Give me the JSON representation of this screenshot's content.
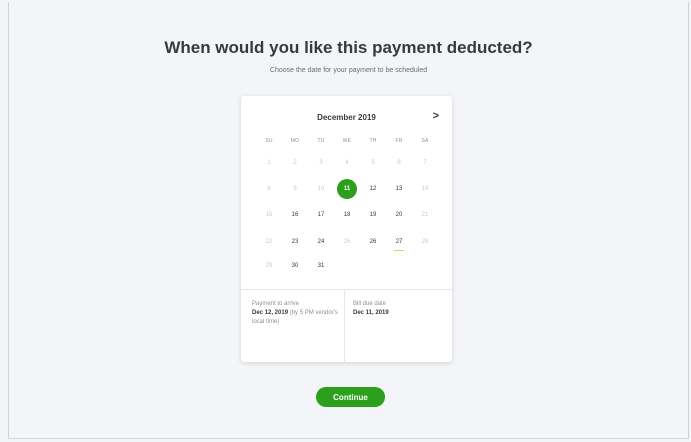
{
  "header": {
    "title": "When would you like this payment deducted?",
    "subtitle": "Choose the date for your payment to be scheduled"
  },
  "calendar": {
    "month_label": "December 2019",
    "next_icon": "chevron-right-icon",
    "next_glyph": ">",
    "weekdays": [
      "SU",
      "MO",
      "TU",
      "WE",
      "TH",
      "FR",
      "SA"
    ],
    "weeks": [
      [
        "1",
        "2",
        "3",
        "4",
        "5",
        "6",
        "7"
      ],
      [
        "8",
        "9",
        "10",
        "11",
        "12",
        "13",
        "14"
      ],
      [
        "15",
        "16",
        "17",
        "18",
        "19",
        "20",
        "21"
      ],
      [
        "22",
        "23",
        "24",
        "25",
        "26",
        "27",
        "28"
      ],
      [
        "29",
        "30",
        "31",
        "",
        "",
        "",
        ""
      ]
    ],
    "selected_day": "11",
    "due_day": "27",
    "accent_color": "#2ca01c",
    "due_marker_color": "#f2c94c"
  },
  "summary": {
    "arrive_label": "Payment to arrive",
    "arrive_date": "Dec 12, 2019",
    "arrive_note": "(by 5 PM vendor's local time)",
    "due_label": "Bill due date",
    "due_date": "Dec 11, 2019"
  },
  "actions": {
    "continue_label": "Continue"
  }
}
